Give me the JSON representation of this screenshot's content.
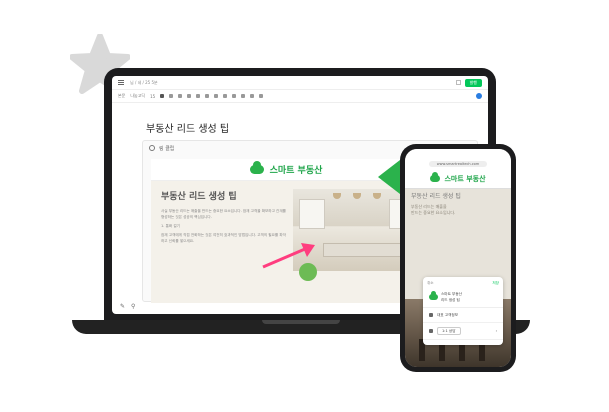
{
  "colors": {
    "brand_green": "#03c75a",
    "logo_green": "#2bb24c",
    "pink_arrow": "#ff3d7f",
    "laptop_body": "#1c1c1e"
  },
  "icons": [
    "star-icon",
    "menu-icon",
    "globe-icon",
    "cloud-logo-icon",
    "pink-arrow-icon",
    "green-arrow-icon",
    "help-icon"
  ],
  "editor": {
    "topbar": {
      "doc_path": "님 / 네 / 25 5분",
      "save_label": "발행"
    },
    "toolbar": {
      "font_label": "본문",
      "font_family": "나눔고딕",
      "font_size": "15"
    },
    "doc_title": "부동산 리드 생성 팁",
    "link_card": {
      "label": "링 클립",
      "brand": "스마트 부동산",
      "heading": "부동산 리드 생성 팁",
      "paragraphs": [
        "사실 부동산 리드는 매출을 만드는 중요한 요소입니다. 잠재 고객을 확보하고 관계를 형성하는 것은 성공의 핵심입니다.",
        "1. 통화 걸기",
        "잠재 고객에게 직접 전화하는 것은 여전히 효과적인 방법입니다. 고객의 필요를 파악하고 신뢰를 쌓으세요."
      ]
    },
    "bottom_icons": [
      "✎",
      "⚲"
    ]
  },
  "phone": {
    "url": "www.smartrealtech.com",
    "brand": "스마트 부동산",
    "heading": "부동산 리드 생성 팁",
    "body_lines": [
      "부동산 리드는 매출을",
      "만드는 중요한 요소입니다."
    ],
    "popup": {
      "cancel": "취소",
      "save": "저장",
      "card_title": "스마트 부동산",
      "card_sub": "리드 생성 팁",
      "row1": "대표 고객정보",
      "row2": "1:1 상담"
    }
  }
}
